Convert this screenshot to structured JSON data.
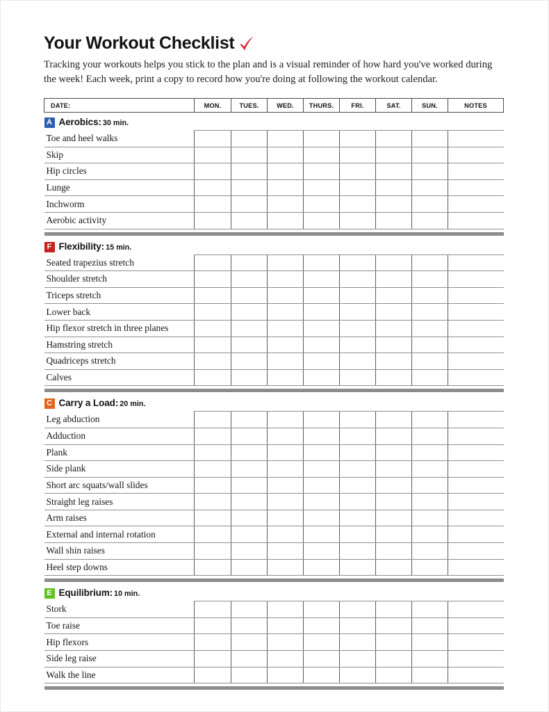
{
  "document": {
    "title": "Your Workout Checklist",
    "title_icon": "red-check-mark-icon",
    "intro": "Tracking your workouts helps you stick to the plan and is a visual reminder of how hard you've worked during the week! Each week, print a copy to record how you're doing at following the workout calendar."
  },
  "table": {
    "columns": [
      {
        "key": "date",
        "label": "DATE:"
      },
      {
        "key": "mon",
        "label": "MON."
      },
      {
        "key": "tues",
        "label": "TUES."
      },
      {
        "key": "wed",
        "label": "WED."
      },
      {
        "key": "thurs",
        "label": "THURS."
      },
      {
        "key": "fri",
        "label": "FRI."
      },
      {
        "key": "sat",
        "label": "SAT."
      },
      {
        "key": "sun",
        "label": "SUN."
      },
      {
        "key": "notes",
        "label": "NOTES"
      }
    ]
  },
  "sections": [
    {
      "badge": "A",
      "badge_color": "#2b5fae",
      "name": "Aerobics:",
      "duration": "30 min.",
      "exercises": [
        "Toe and heel walks",
        "Skip",
        "Hip circles",
        "Lunge",
        "Inchworm",
        "Aerobic activity"
      ]
    },
    {
      "badge": "F",
      "badge_color": "#c7211d",
      "name": "Flexibility:",
      "duration": "15 min.",
      "exercises": [
        "Seated trapezius stretch",
        "Shoulder stretch",
        "Triceps stretch",
        "Lower back",
        "Hip flexor stretch in three planes",
        "Hamstring stretch",
        "Quadriceps stretch",
        "Calves"
      ]
    },
    {
      "badge": "C",
      "badge_color": "#e2641b",
      "name": "Carry a Load:",
      "duration": "20 min.",
      "exercises": [
        "Leg abduction",
        "Adduction",
        "Plank",
        "Side plank",
        "Short arc squats/wall slides",
        "Straight leg raises",
        "Arm raises",
        "External and internal rotation",
        "Wall shin raises",
        "Heel step downs"
      ]
    },
    {
      "badge": "E",
      "badge_color": "#5dc21e",
      "name": "Equilibrium:",
      "duration": "10 min.",
      "exercises": [
        "Stork",
        "Toe raise",
        "Hip flexors",
        "Side leg raise",
        "Walk the line"
      ]
    }
  ],
  "theme": {
    "check_mark_color": "#d8232a",
    "divider_color": "#8c8c8c",
    "grid_line_color": "#8e8e8e",
    "header_border_color": "#4a4a4a"
  }
}
